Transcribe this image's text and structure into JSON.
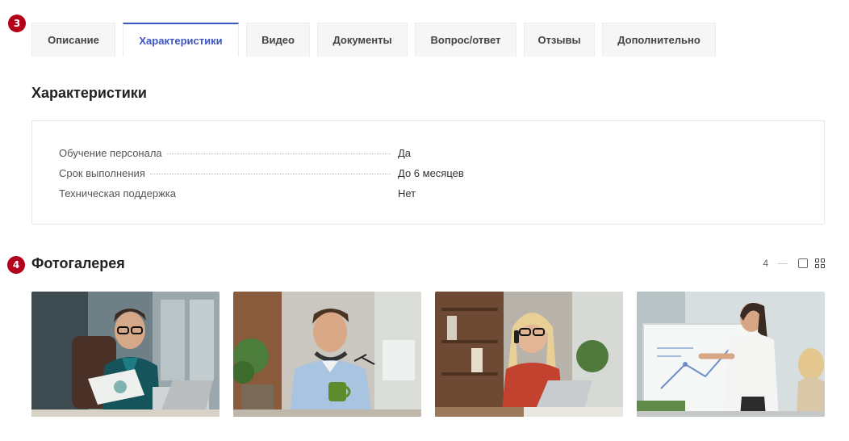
{
  "badges": {
    "tabs_step": "3",
    "gallery_step": "4"
  },
  "tabs": [
    {
      "label": "Описание",
      "active": false
    },
    {
      "label": "Характеристики",
      "active": true
    },
    {
      "label": "Видео",
      "active": false
    },
    {
      "label": "Документы",
      "active": false
    },
    {
      "label": "Вопрос/ответ",
      "active": false
    },
    {
      "label": "Отзывы",
      "active": false
    },
    {
      "label": "Дополнительно",
      "active": false
    }
  ],
  "characteristics": {
    "title": "Характеристики",
    "rows": [
      {
        "name": "Обучение персонала",
        "value": "Да"
      },
      {
        "name": "Срок выполнения",
        "value": "До 6 месяцев"
      },
      {
        "name": "Техническая поддержка",
        "value": "Нет"
      }
    ]
  },
  "gallery": {
    "title": "Фотогалерея",
    "count": "4",
    "photos": [
      {
        "icon": "photo-man-glasses-laptop"
      },
      {
        "icon": "photo-man-headphones-coffee"
      },
      {
        "icon": "photo-woman-phone-laptop"
      },
      {
        "icon": "photo-woman-whiteboard"
      }
    ]
  },
  "colors": {
    "accent": "#3b54c6",
    "badge": "#b3001b"
  }
}
